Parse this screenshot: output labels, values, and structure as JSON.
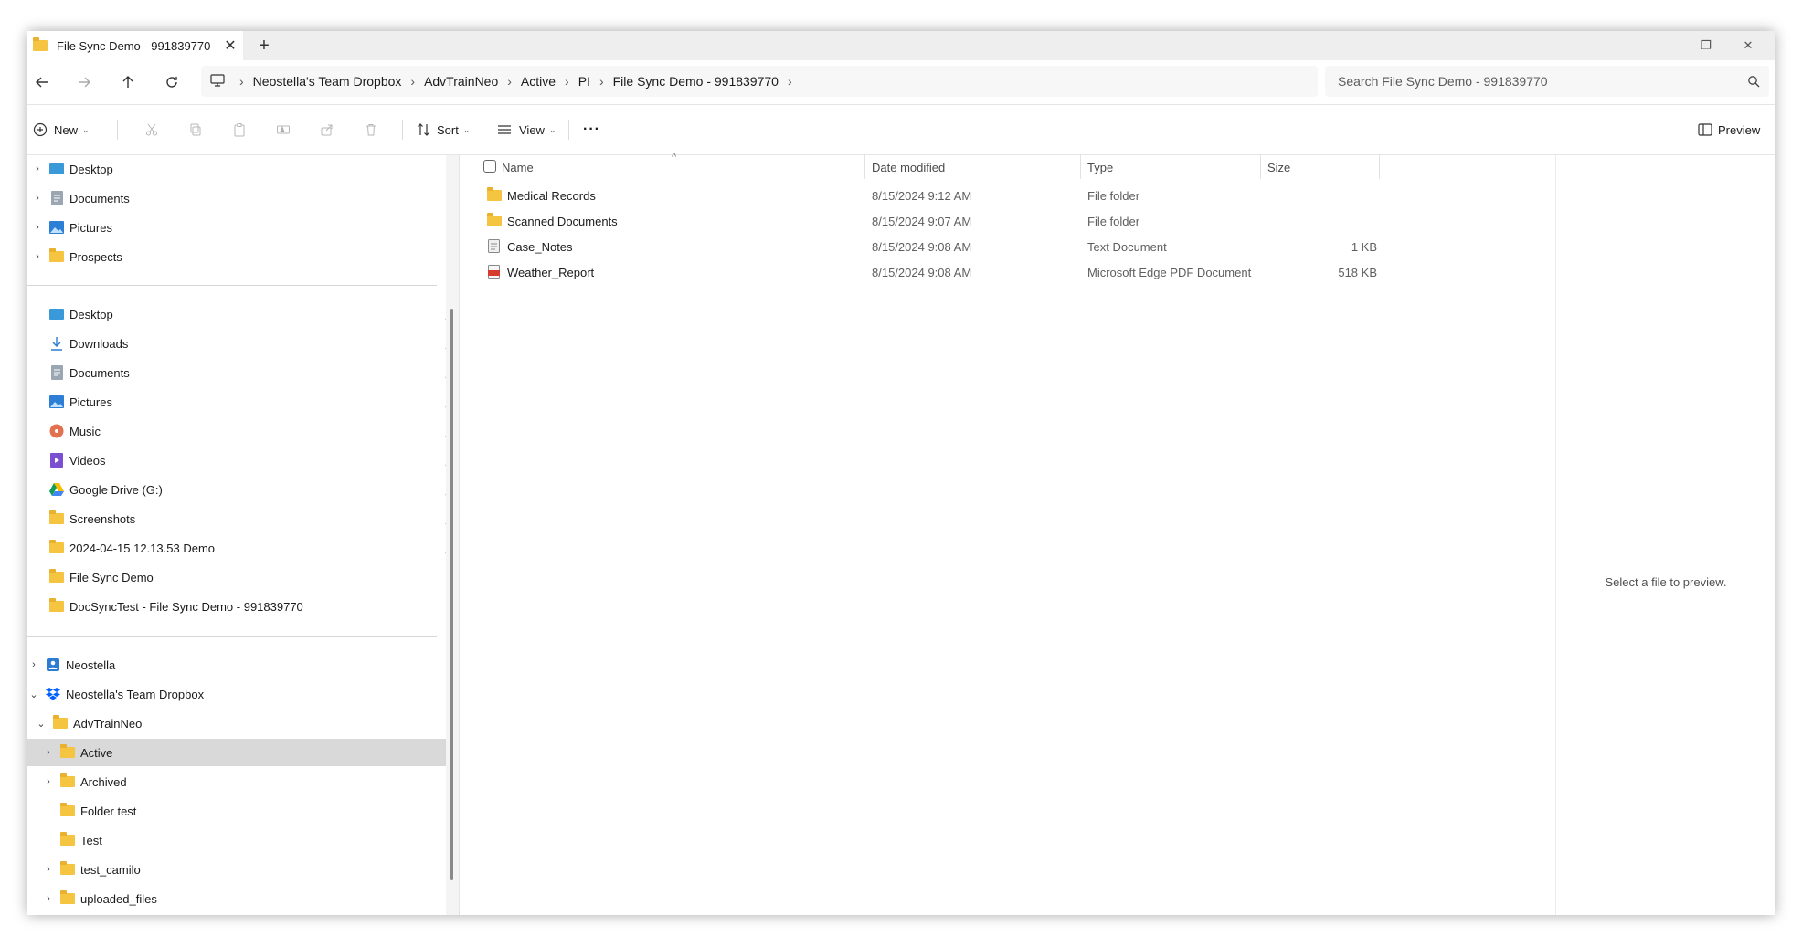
{
  "window": {
    "tab_title": "File Sync Demo - 991839770",
    "tab_close": "✕",
    "new_tab": "+",
    "controls": {
      "minimize": "—",
      "maximize": "❐",
      "close": "✕"
    }
  },
  "address": {
    "breadcrumb": [
      "Neostella's Team Dropbox",
      "AdvTrainNeo",
      "Active",
      "PI",
      "File Sync Demo - 991839770"
    ],
    "search_placeholder": "Search File Sync Demo - 991839770"
  },
  "toolbar": {
    "new_label": "New",
    "sort_label": "Sort",
    "view_label": "View",
    "more_label": "···",
    "preview_label": "Preview"
  },
  "nav": {
    "top_group": [
      {
        "label": "Desktop",
        "icon": "desktop-icon"
      },
      {
        "label": "Documents",
        "icon": "documents-icon"
      },
      {
        "label": "Pictures",
        "icon": "pictures-icon"
      },
      {
        "label": "Prospects",
        "icon": "folder-icon"
      }
    ],
    "quick_access": [
      {
        "label": "Desktop",
        "icon": "desktop-icon",
        "pinned": true
      },
      {
        "label": "Downloads",
        "icon": "download-icon",
        "pinned": true
      },
      {
        "label": "Documents",
        "icon": "documents-icon",
        "pinned": true
      },
      {
        "label": "Pictures",
        "icon": "pictures-icon",
        "pinned": true
      },
      {
        "label": "Music",
        "icon": "music-icon",
        "pinned": true
      },
      {
        "label": "Videos",
        "icon": "videos-icon",
        "pinned": true
      },
      {
        "label": "Google Drive (G:)",
        "icon": "google-drive-icon",
        "pinned": true
      },
      {
        "label": "Screenshots",
        "icon": "folder-icon",
        "pinned": true
      },
      {
        "label": "2024-04-15 12.13.53 Demo",
        "icon": "folder-icon",
        "pinned": true
      },
      {
        "label": "File Sync Demo",
        "icon": "folder-icon",
        "pinned": false
      },
      {
        "label": "DocSyncTest - File Sync Demo - 991839770",
        "icon": "folder-icon",
        "pinned": false
      }
    ],
    "tree": [
      {
        "label": "Neostella",
        "icon": "onedrive-person-icon"
      },
      {
        "label": "Neostella's Team Dropbox",
        "icon": "dropbox-icon"
      },
      {
        "label": "AdvTrainNeo",
        "icon": "folder-icon"
      },
      {
        "label": "Active",
        "icon": "folder-icon",
        "selected": true
      },
      {
        "label": "Archived",
        "icon": "folder-icon"
      },
      {
        "label": "Folder test",
        "icon": "folder-icon"
      },
      {
        "label": "Test",
        "icon": "folder-icon"
      },
      {
        "label": "test_camilo",
        "icon": "folder-icon"
      },
      {
        "label": "uploaded_files",
        "icon": "folder-icon"
      }
    ]
  },
  "columns": {
    "name": "Name",
    "date": "Date modified",
    "type": "Type",
    "size": "Size"
  },
  "files": [
    {
      "name": "Medical Records",
      "date": "8/15/2024 9:12 AM",
      "type": "File folder",
      "size": "",
      "icon": "folder-icon"
    },
    {
      "name": "Scanned Documents",
      "date": "8/15/2024 9:07 AM",
      "type": "File folder",
      "size": "",
      "icon": "folder-icon"
    },
    {
      "name": "Case_Notes",
      "date": "8/15/2024 9:08 AM",
      "type": "Text Document",
      "size": "1 KB",
      "icon": "text-document-icon"
    },
    {
      "name": "Weather_Report",
      "date": "8/15/2024 9:08 AM",
      "type": "Microsoft Edge PDF Document",
      "size": "518 KB",
      "icon": "pdf-icon"
    }
  ],
  "preview_text": "Select a file to preview.",
  "colors": {
    "folder": "#f5c542",
    "selected_row": "#d9d9d9",
    "accent": "#0067c0"
  }
}
